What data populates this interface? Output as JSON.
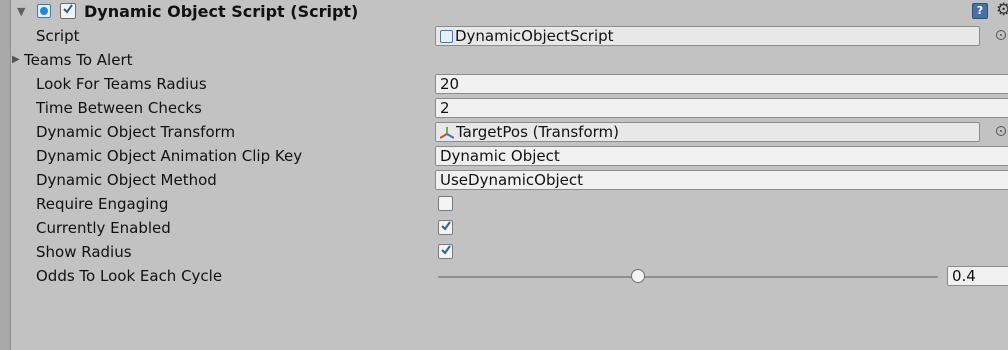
{
  "component": {
    "title": "Dynamic Object Script (Script)",
    "enabled": true,
    "icons": {
      "script": "script-icon",
      "help": "help-icon",
      "settings": "gear-icon"
    }
  },
  "fields": {
    "script": {
      "label": "Script",
      "value": "DynamicObjectScript"
    },
    "teams_to_alert": {
      "label": "Teams To Alert"
    },
    "look_for_teams_radius": {
      "label": "Look For Teams Radius",
      "value": "20"
    },
    "time_between_checks": {
      "label": "Time Between Checks",
      "value": "2"
    },
    "dynamic_object_transform": {
      "label": "Dynamic Object Transform",
      "value": "TargetPos (Transform)"
    },
    "animation_clip_key": {
      "label": "Dynamic Object Animation Clip Key",
      "value": "Dynamic Object"
    },
    "dynamic_object_method": {
      "label": "Dynamic Object Method",
      "value": "UseDynamicObject"
    },
    "require_engaging": {
      "label": "Require Engaging",
      "checked": false
    },
    "currently_enabled": {
      "label": "Currently Enabled",
      "checked": true
    },
    "show_radius": {
      "label": "Show Radius",
      "checked": true
    },
    "odds_to_look": {
      "label": "Odds To Look Each Cycle",
      "value": "0.4",
      "fraction": 0.4
    }
  }
}
